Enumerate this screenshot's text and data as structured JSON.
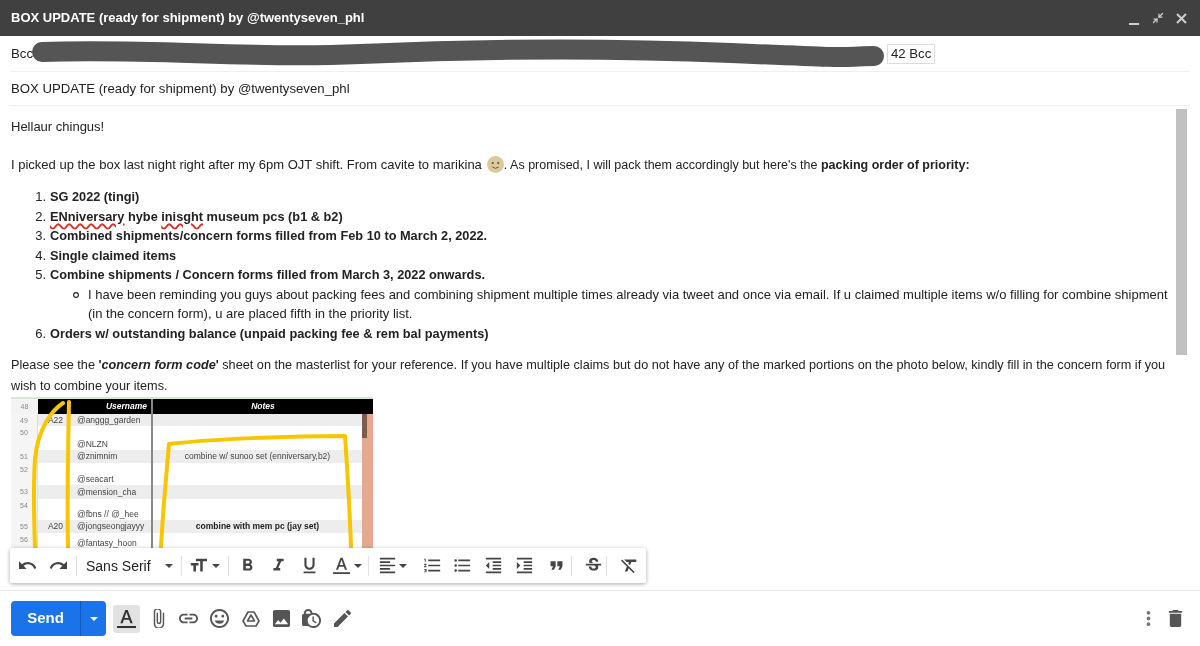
{
  "window": {
    "title": "BOX UPDATE (ready for shipment) by @twentyseven_phl"
  },
  "recipients": {
    "label": "Bcc",
    "count_chip": "42 Bcc"
  },
  "subject": {
    "value": "BOX UPDATE (ready for shipment) by @twentyseven_phl"
  },
  "body": {
    "greeting": "Hellaur chingus!",
    "intro": {
      "before_emoji": "I picked up the box last night right after my 6pm OJT shift. From cavite to marikina",
      "after_emoji": ". As promised, I will pack them accordingly but here's the **packing order of priority:**"
    },
    "priority_list": [
      {
        "number": "1.",
        "text": "SG 2022 (tingi)"
      },
      {
        "number": "2.",
        "segments": [
          {
            "text": "ENniversary",
            "misspelled": true
          },
          {
            "text": " hybe ",
            "misspelled": false
          },
          {
            "text": "inisght",
            "misspelled": true
          },
          {
            "text": " museum pcs (b1 & b2)",
            "misspelled": false
          }
        ]
      },
      {
        "number": "3.",
        "text": "Combined shipments/concern forms filled from Feb 10 to March 2, 2022."
      },
      {
        "number": "4.",
        "text": "Single claimed items"
      },
      {
        "number": "5.",
        "text": "Combine shipments / Concern forms filled from March 3, 2022 onwards.",
        "children": [
          {
            "text": "I have been reminding you guys about packing fees and combining shipment multiple times already via tweet and once via email. If u claimed multiple items w/o filling for combine shipment (in the concern form), u are placed fifth in the priority list."
          }
        ]
      },
      {
        "number": "6.",
        "text": "Orders w/ outstanding balance (unpaid packing fee & rem bal payments)"
      }
    ],
    "closing": "Please see the **'*concern form code*'** sheet on the masterlist for your reference. If you have multiple claims but do not have any of the marked portions on the photo below, kindly fill in the concern form if you wish to combine your items.",
    "pasted_image": {
      "header": {
        "row_number": "48",
        "username": "Username",
        "notes": "Notes"
      },
      "rows": [
        {
          "row_number": "49",
          "code": "A22",
          "username": "@anggg_garden"
        },
        {
          "row_number": "50",
          "username": "@NLZN"
        },
        {
          "row_number": "51",
          "username": "@znimnim",
          "notes": "combine w/ sunoo set (enniversary,b2)",
          "notes_bold": false
        },
        {
          "row_number": "52",
          "username": "@seacart"
        },
        {
          "row_number": "53",
          "username": "@mension_cha"
        },
        {
          "row_number": "54",
          "username": "@fbns // @_hee"
        },
        {
          "row_number": "55",
          "code": "A20",
          "username": "@jongseongjayyy",
          "notes": "combine with mem pc (jay set)",
          "notes_bold": true
        },
        {
          "row_number": "56",
          "username": "@fantasy_hoon"
        }
      ]
    }
  },
  "formatting_bar": {
    "font": "Sans Serif"
  },
  "bottom_bar": {
    "send": "Send",
    "formatting_toggle": {
      "selected": true
    }
  }
}
